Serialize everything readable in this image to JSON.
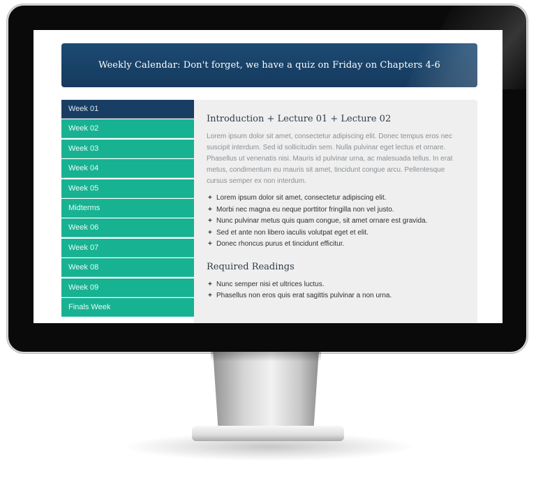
{
  "banner": {
    "text": "Weekly Calendar: Don't forget, we have a quiz on Friday on Chapters 4-6"
  },
  "sidebar": {
    "items": [
      {
        "label": "Week 01"
      },
      {
        "label": "Week 02"
      },
      {
        "label": "Week 03"
      },
      {
        "label": "Week 04"
      },
      {
        "label": "Week 05"
      },
      {
        "label": "Midterms"
      },
      {
        "label": "Week 06"
      },
      {
        "label": "Week 07"
      },
      {
        "label": "Week 08"
      },
      {
        "label": "Week 09"
      },
      {
        "label": "Finals Week"
      }
    ],
    "active_index": 0
  },
  "content": {
    "title": "Introduction + Lecture 01 + Lecture 02",
    "paragraph": "Lorem ipsum dolor sit amet, consectetur adipiscing elit. Donec tempus eros nec suscipit interdum. Sed id sollicitudin sem. Nulla pulvinar eget lectus et ornare. Phasellus ut venenatis nisi. Mauris id pulvinar urna, ac malesuada tellus. In erat metus, condimentum eu mauris sit amet, tincidunt congue arcu. Pellentesque cursus semper ex non interdum.",
    "bullets": [
      "Lorem ipsum dolor sit amet, consectetur adipiscing elit.",
      "Morbi nec magna eu neque porttitor fringilla non vel justo.",
      "Nunc pulvinar metus quis quam congue, sit amet ornare est gravida.",
      "Sed et ante non libero iaculis volutpat eget et elit.",
      "Donec rhoncus purus et tincidunt efficitur."
    ],
    "readings_title": "Required Readings",
    "readings": [
      "Nunc semper nisi et ultrices luctus.",
      "Phasellus non eros quis erat sagittis pulvinar a non urna."
    ],
    "bullet_symbol": "+"
  },
  "colors": {
    "banner": "#1d4a72",
    "sidebar_item": "#17b292",
    "sidebar_active": "#183e63",
    "content_bg": "#efefef"
  }
}
